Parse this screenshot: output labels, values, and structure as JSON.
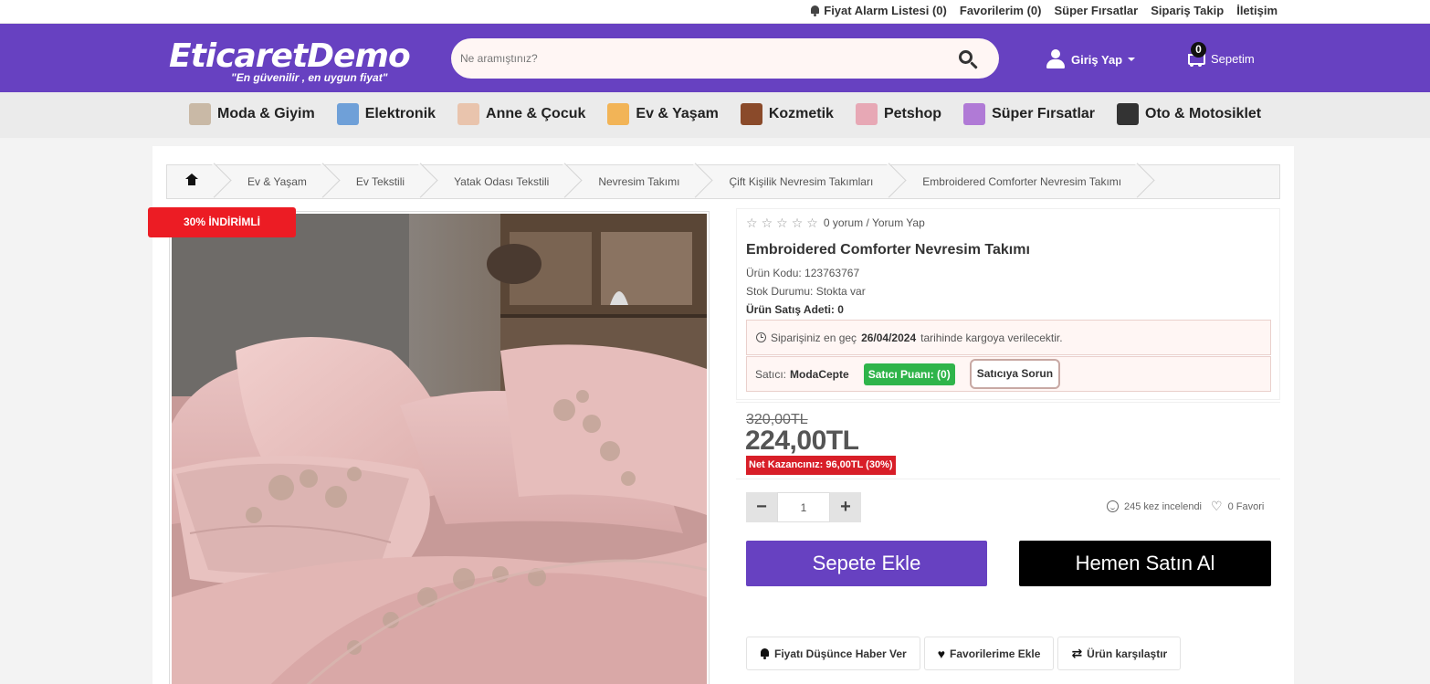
{
  "topbar": {
    "links": [
      "Fiyat Alarm Listesi (0)",
      "Favorilerim (0)",
      "Süper Fırsatlar",
      "Sipariş Takip",
      "İletişim"
    ]
  },
  "header": {
    "logo_main": "EticaretDemo",
    "logo_sub": "\"En güvenilir , en uygun fiyat\"",
    "search_placeholder": "Ne aramıştınız?",
    "login_label": "Giriş Yap",
    "cart_label": "Sepetim",
    "cart_count": "0",
    "accent": "#6741c1"
  },
  "categories": [
    {
      "label": "Moda & Giyim",
      "icon": "fashion-icon",
      "color": "#c9b9a6"
    },
    {
      "label": "Elektronik",
      "icon": "phone-icon",
      "color": "#6fa0d8"
    },
    {
      "label": "Anne & Çocuk",
      "icon": "baby-icon",
      "color": "#e9c4ad"
    },
    {
      "label": "Ev & Yaşam",
      "icon": "lamp-icon",
      "color": "#f2b457"
    },
    {
      "label": "Kozmetik",
      "icon": "brush-icon",
      "color": "#8a4a2a"
    },
    {
      "label": "Petshop",
      "icon": "pet-icon",
      "color": "#e7a8b5"
    },
    {
      "label": "Süper Fırsatlar",
      "icon": "deal-badge-icon",
      "color": "#b07ad6"
    },
    {
      "label": "Oto & Motosiklet",
      "icon": "wheel-icon",
      "color": "#333333"
    }
  ],
  "breadcrumb": [
    "Ev & Yaşam",
    "Ev Tekstili",
    "Yatak Odası Tekstili",
    "Nevresim Takımı",
    "Çift Kişilik Nevresim Takımları",
    "Embroidered Comforter Nevresim Takımı"
  ],
  "product": {
    "discount_badge": "30% İNDİRİMLİ",
    "review_text": "0 yorum / Yorum Yap",
    "rating": 0,
    "title": "Embroidered Comforter Nevresim Takımı",
    "code_label": "Ürün Kodu:",
    "code": "123763767",
    "stock_label": "Stok Durumu:",
    "stock": "Stokta var",
    "sales_label": "Ürün Satış Adeti:",
    "sales": "0",
    "ship_prefix": "Siparişiniz en geç",
    "ship_date": "26/04/2024",
    "ship_suffix": "tarihinde kargoya verilecektir.",
    "seller_label": "Satıcı:",
    "seller_name": "ModaCepte",
    "seller_score": "Satıcı Puanı: (0)",
    "ask_seller": "Satıcıya Sorun",
    "old_price": "320,00TL",
    "new_price": "224,00TL",
    "saving": "Net Kazancınız: 96,00TL (30%)",
    "quantity": "1",
    "views": "245 kez incelendi",
    "favorites": "0 Favori",
    "add_to_cart": "Sepete Ekle",
    "buy_now": "Hemen Satın Al",
    "price_alert": "Fiyatı Düşünce Haber Ver",
    "add_favorite": "Favorilerime Ekle",
    "compare": "Ürün karşılaştır"
  }
}
